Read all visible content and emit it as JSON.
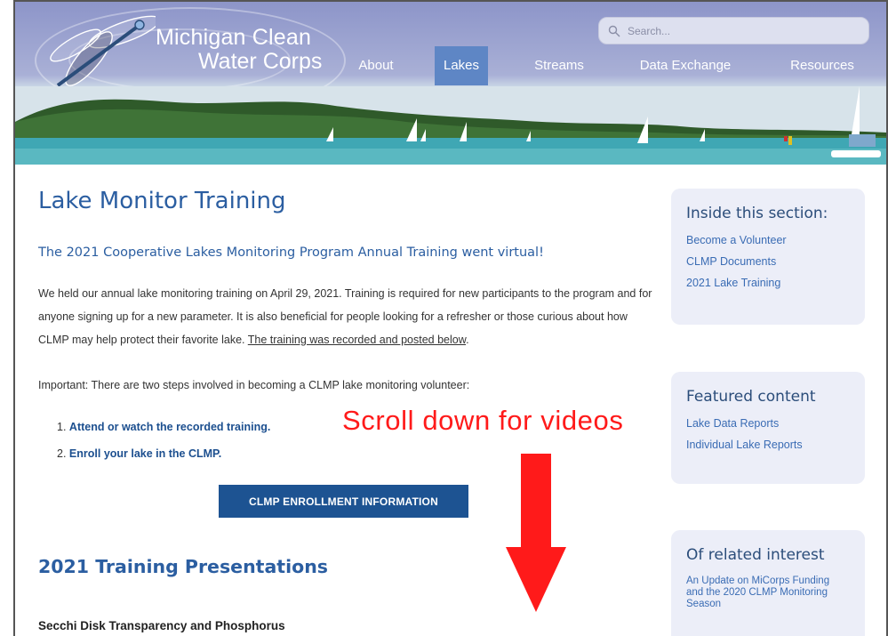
{
  "site": {
    "name_line1": "Michigan Clean",
    "name_line2": "Water Corps"
  },
  "search": {
    "placeholder": "Search..."
  },
  "nav": {
    "items": [
      {
        "label": "About"
      },
      {
        "label": "Lakes",
        "active": true
      },
      {
        "label": "Streams"
      },
      {
        "label": "Data Exchange"
      },
      {
        "label": "Resources"
      }
    ]
  },
  "main": {
    "title": "Lake Monitor Training",
    "subtitle": "The 2021 Cooperative Lakes Monitoring Program Annual Training went virtual!",
    "intro_text": "We held our annual lake monitoring training on April 29, 2021. Training is required for new participants to the program and for anyone signing up for a new parameter. It is also beneficial for people looking for a refresher or those curious about how CLMP may help protect their favorite lake. ",
    "intro_link": "The training was recorded and posted below",
    "intro_end": ".",
    "important": "Important: There are two steps involved in becoming a CLMP lake monitoring volunteer:",
    "steps": [
      {
        "num": "1.",
        "label": "Attend or watch the recorded training."
      },
      {
        "num": "2.",
        "label": "Enroll your lake in the CLMP."
      }
    ],
    "enroll_button": "CLMP ENROLLMENT INFORMATION",
    "section_title": "2021 Training Presentations",
    "presentation_title": "Secchi Disk Transparency and Phosphorus"
  },
  "sidebar": {
    "inside": {
      "title": "Inside this section:",
      "links": [
        "Become a Volunteer",
        "CLMP Documents",
        "2021 Lake Training"
      ]
    },
    "featured": {
      "title": "Featured content",
      "links": [
        "Lake Data Reports",
        "Individual Lake Reports"
      ]
    },
    "related": {
      "title": "Of related interest",
      "links": [
        "An Update on MiCorps Funding and the 2020 CLMP Monitoring Season"
      ]
    }
  },
  "overlay": {
    "hint": "Scroll down for videos",
    "color": "#ff1a1a"
  },
  "colors": {
    "header_bg": "#8d95c9",
    "nav_active": "#5e86c5",
    "heading_blue": "#2b5ea1",
    "button_blue": "#1d5392",
    "sidebar_bg": "#eceef8"
  }
}
